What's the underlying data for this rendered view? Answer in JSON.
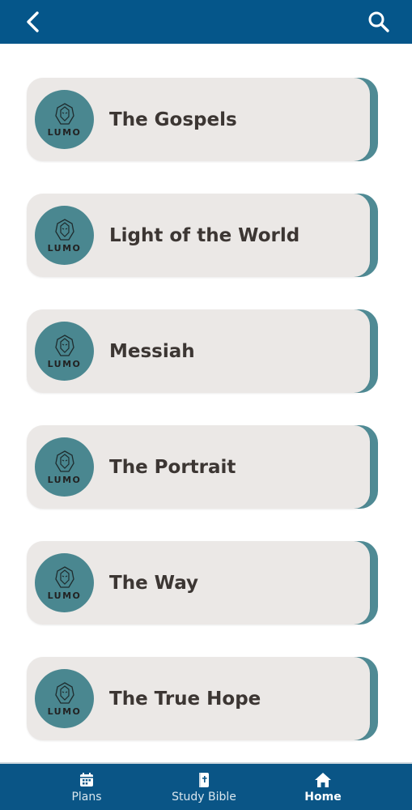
{
  "header": {
    "back_icon": "chevron-left-icon",
    "search_icon": "search-icon"
  },
  "plans": {
    "logo_text": "LUMO",
    "items": [
      {
        "title": "The Gospels"
      },
      {
        "title": "Light of the World"
      },
      {
        "title": "Messiah"
      },
      {
        "title": "The Portrait"
      },
      {
        "title": "The Way"
      },
      {
        "title": "The True Hope"
      }
    ]
  },
  "bottom_nav": {
    "tabs": [
      {
        "label": "Plans",
        "icon": "calendar-icon"
      },
      {
        "label": "Study Bible",
        "icon": "bible-icon"
      },
      {
        "label": "Home",
        "icon": "home-icon",
        "active": true
      }
    ]
  },
  "colors": {
    "header_bg": "#05568a",
    "card_bg": "#ebe8e6",
    "card_accent": "#4f8a94",
    "logo_bg": "#4a8790",
    "title_text": "#3c3633",
    "nav_bg": "#0a5586"
  }
}
